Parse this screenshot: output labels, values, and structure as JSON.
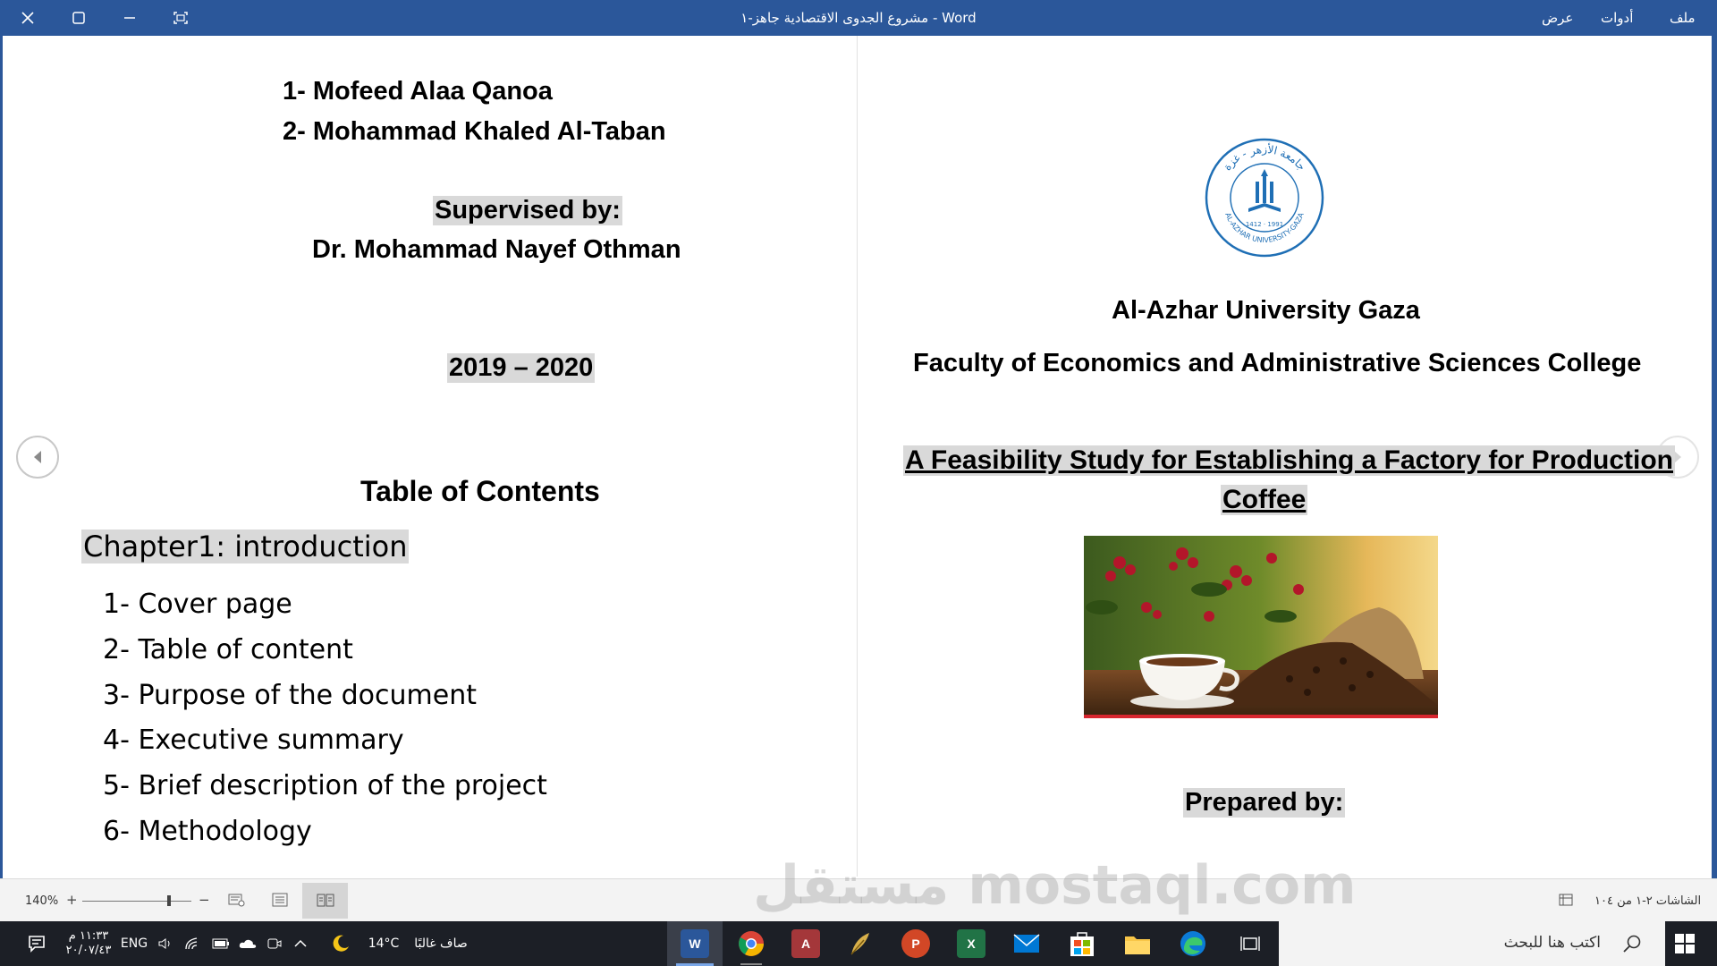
{
  "window": {
    "title": "مشروع الجدوى الاقتصادية جاهز-١  -  Word",
    "menu": [
      "ملف",
      "أدوات",
      "عرض"
    ]
  },
  "left_page": {
    "names": [
      "1- Mofeed Alaa Qanoa",
      "2- Mohammad Khaled Al-Taban"
    ],
    "supervised_label": "Supervised by:",
    "supervisor": "Dr. Mohammad Nayef Othman",
    "year": "2019 – 2020",
    "toc_title": "Table of Contents",
    "chapter": "Chapter1: introduction",
    "toc_items": [
      "1- Cover page",
      "2- Table of content",
      "3- Purpose of the document",
      "4- Executive summary",
      "5- Brief description of the project",
      "6- Methodology"
    ]
  },
  "right_page": {
    "logo_text_top": "جامعة الأزهر - غزة",
    "logo_text_bottom": "AL-AZHAR UNIVERSITY-GAZA",
    "logo_years": "1412 · 1991",
    "university": "Al-Azhar University Gaza",
    "faculty": "Faculty of Economics and Administrative Sciences College",
    "study_title_line1": "A Feasibility Study for Establishing a Factory for Production",
    "study_title_line2": "Coffee",
    "prepared_label": "Prepared by:"
  },
  "statusbar": {
    "screens": "الشاشات ٢-١ من ١٠٤",
    "zoom": "140%"
  },
  "taskbar": {
    "search_placeholder": "اكتب هنا للبحث",
    "weather_text": "صاف غالبًا",
    "temperature": "14°C",
    "language": "ENG",
    "time": "١١:٣٣ م",
    "date": "٢٠/٠٧/٤٣",
    "apps": [
      "W",
      "A",
      "P",
      "X"
    ]
  },
  "colors": {
    "titlebar": "#2b579a",
    "taskbar": "#1c1f26",
    "highlight": "#d9d9d9",
    "logo_blue": "#1f6fb5"
  },
  "watermark": "مستقل mostaql.com"
}
